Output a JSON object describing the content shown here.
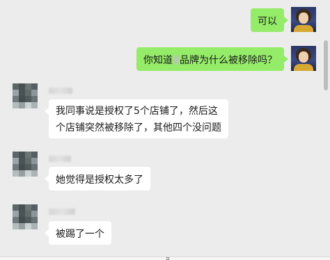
{
  "messages": [
    {
      "sender": "self",
      "text": "可以"
    },
    {
      "sender": "self",
      "text_before": "你知道",
      "text_after": "品牌为什么被移除吗？"
    },
    {
      "sender": "other",
      "lines": [
        "我同事说是授权了5个店铺了，然后这",
        "个店铺突然被移除了，其他四个没问题"
      ]
    },
    {
      "sender": "other",
      "text": "她觉得是授权太多了"
    },
    {
      "sender": "other",
      "text": "被踢了一个"
    }
  ],
  "colors": {
    "background": "#ececec",
    "self_bubble": "#95ec69",
    "other_bubble": "#ffffff"
  }
}
